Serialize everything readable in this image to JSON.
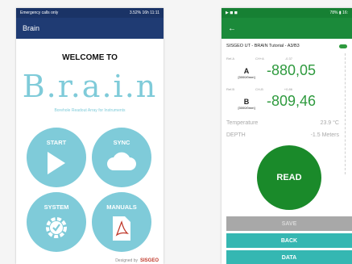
{
  "colors": {
    "appbar": "#1f3b73",
    "statusbar": "#1a3366",
    "tile": "#7fcbd9",
    "logo": "#7fcbd9",
    "tagline": "#7fcbd9",
    "phone2_bar": "#1b8a3a",
    "phone2_status": "#168033",
    "value_green": "#2e9a3e",
    "read_button": "#1a8a2a",
    "save_bar": "#a8a8a8",
    "teal_bar": "#35b7b2"
  },
  "phone1": {
    "statusbar": {
      "left": "Emergency calls only",
      "right": "3.52% 16h 11:11"
    },
    "appbar_title": "Brain",
    "welcome": "WELCOME TO",
    "logo_text": "B.r.a.i.n",
    "tagline": "Borehole Readout Array for Instruments",
    "tiles": [
      {
        "label": "START",
        "icon": "play-icon"
      },
      {
        "label": "SYNC",
        "icon": "cloud-icon"
      },
      {
        "label": "SYSTEM",
        "icon": "gear-check-icon"
      },
      {
        "label": "MANUALS",
        "icon": "pdf-icon"
      }
    ],
    "footer_text": "Designed by",
    "footer_brand": "SISGEO"
  },
  "phone2": {
    "statusbar": {
      "left": "▶ ◼ ◼",
      "right": "78% ▮ 16:"
    },
    "back_arrow": "←",
    "title": "SISGEO UT - BRAIN Tutorial - A3/B3",
    "channel_a": {
      "ref": "Ref.A",
      "cha": "CH+A",
      "cha_val": "-0.37",
      "letter": "A",
      "unit": "[3000/0mm]",
      "value": "-880,05"
    },
    "channel_b": {
      "ref": "Ref.B",
      "cha": "CH-B",
      "cha_val": "+0.86",
      "letter": "B",
      "unit": "[3000/0mm]",
      "value": "-809,46"
    },
    "temperature_label": "Temperature",
    "temperature_value": "23.9 °C",
    "depth_label": "DEPTH",
    "depth_value": "-1.5 Meters",
    "read_label": "READ",
    "save_label": "SAVE",
    "back_label": "BACK",
    "data_label": "DATA"
  }
}
